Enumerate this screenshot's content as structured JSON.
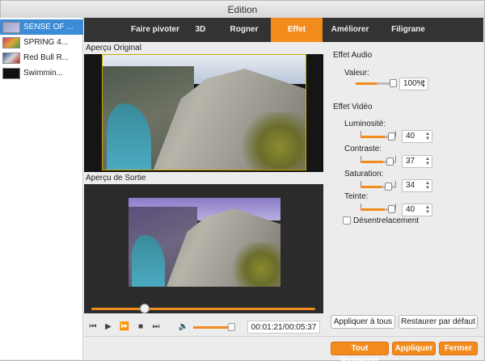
{
  "window": {
    "title": "Edition"
  },
  "files": [
    {
      "name": "SENSE OF ...",
      "selected": true
    },
    {
      "name": "SPRING 4...",
      "selected": false
    },
    {
      "name": "Red Bull R...",
      "selected": false
    },
    {
      "name": "Swimmin...",
      "selected": false
    }
  ],
  "tabs": [
    {
      "label": "Faire pivoter",
      "active": false
    },
    {
      "label": "3D",
      "active": false
    },
    {
      "label": "Rogner",
      "active": false
    },
    {
      "label": "Effet",
      "active": true
    },
    {
      "label": "Améliorer",
      "active": false
    },
    {
      "label": "Filigrane",
      "active": false
    }
  ],
  "preview": {
    "original_label": "Aperçu Original",
    "output_label": "Aperçu de Sortie"
  },
  "player": {
    "time": "00:01:21/00:05:37",
    "icons": [
      "skip-back-icon",
      "play-icon",
      "fast-forward-icon",
      "stop-icon",
      "skip-forward-icon",
      "volume-icon"
    ]
  },
  "effects": {
    "audio_heading": "Effet Audio",
    "volume_label": "Valeur:",
    "volume_value": "100%",
    "video_heading": "Effet Vidéo",
    "brightness_label": "Luminosité:",
    "brightness_value": "40",
    "contrast_label": "Contraste:",
    "contrast_value": "37",
    "saturation_label": "Saturation:",
    "saturation_value": "34",
    "hue_label": "Teinte:",
    "hue_value": "40",
    "deinterlace_label": "Désentrelacement"
  },
  "buttons": {
    "apply_all": "Appliquer à tous",
    "restore_default": "Restaurer par défaut",
    "restore_all": "Tout Restaurer",
    "apply": "Appliquer",
    "close": "Fermer"
  },
  "colors": {
    "accent": "#f28a1c",
    "selection": "#3b8bd7",
    "tabbar": "#333333"
  }
}
